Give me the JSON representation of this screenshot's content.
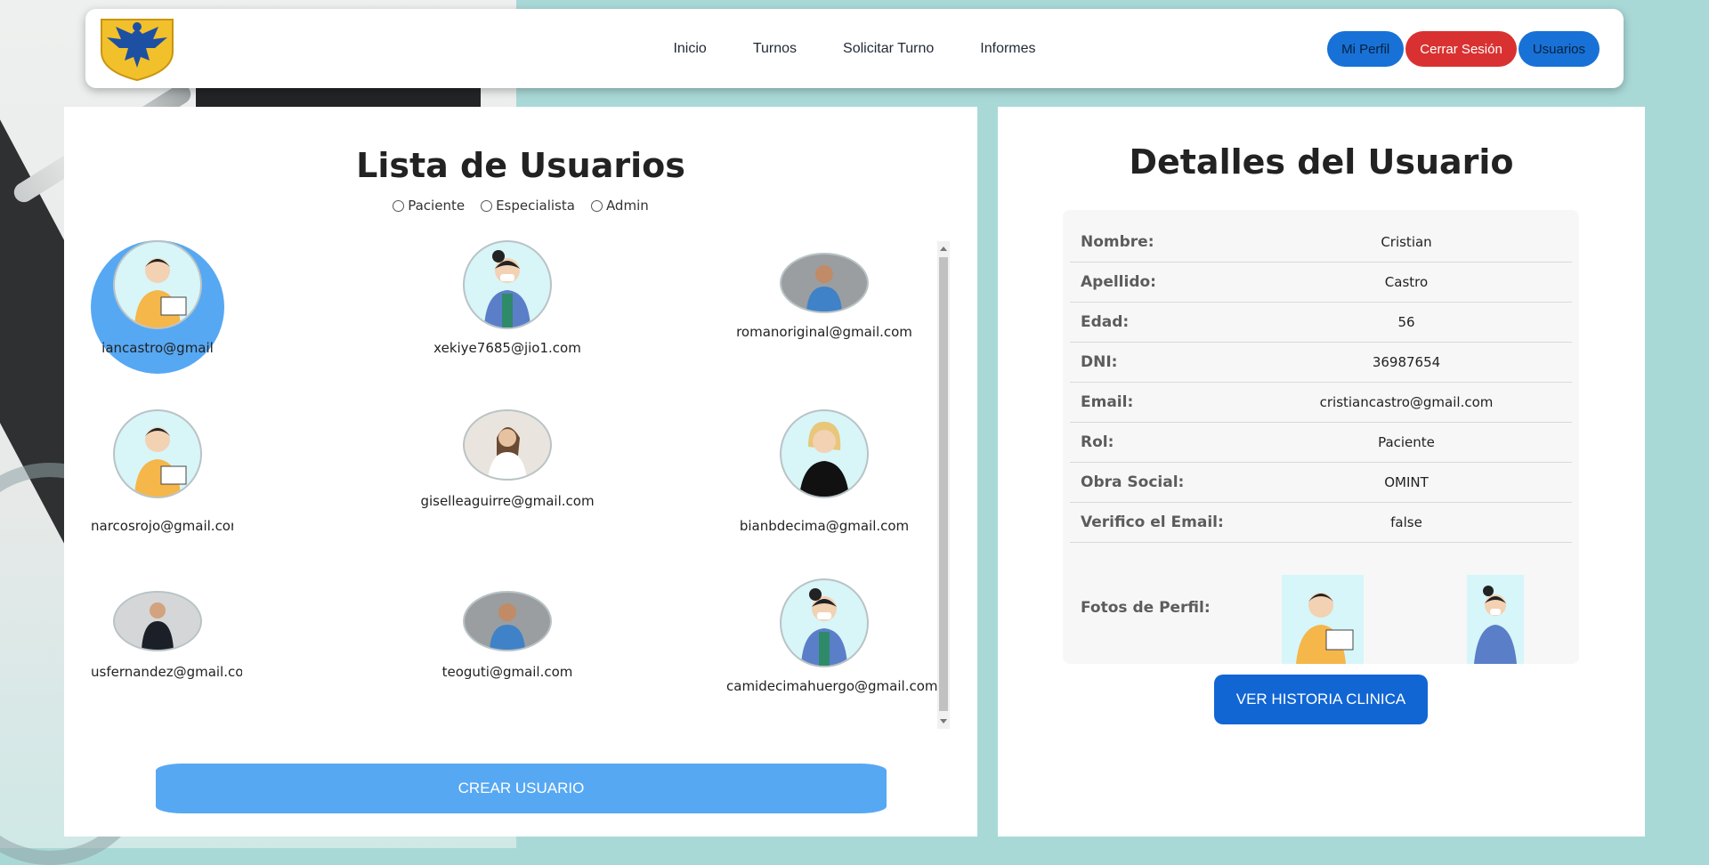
{
  "nav": {
    "links": [
      "Inicio",
      "Turnos",
      "Solicitar Turno",
      "Informes"
    ],
    "mi_perfil": "Mi Perfil",
    "cerrar_sesion": "Cerrar Sesión",
    "usuarios": "Usuarios"
  },
  "list": {
    "title": "Lista de Usuarios",
    "filters": [
      "Paciente",
      "Especialista",
      "Admin"
    ],
    "users": [
      {
        "email": "cristiancastro@gmail.com",
        "display": "iancastro@gmail",
        "avatar": "cartoon-man-laptop-icon",
        "selected": true
      },
      {
        "email": "xekiye7685@jio1.com",
        "display": "xekiye7685@jio1.com",
        "avatar": "cartoon-woman-mask-icon"
      },
      {
        "email": "romanoriginal@gmail.com",
        "display": "romanoriginal@gmail.com",
        "avatar": "photo-man-icon"
      },
      {
        "email": "marcosrojo@gmail.com",
        "display": "narcosrojo@gmail.com",
        "avatar": "cartoon-man-laptop-icon"
      },
      {
        "email": "giselleaguirre@gmail.com",
        "display": "giselleaguirre@gmail.com",
        "avatar": "photo-doctor-woman-icon"
      },
      {
        "email": "bianbdecima@gmail.com",
        "display": "bianbdecima@gmail.com",
        "avatar": "cartoon-woman-blonde-icon"
      },
      {
        "email": "usfernandez@gmail.com",
        "display": "usfernandez@gmail.com",
        "avatar": "photo-man-suit-icon"
      },
      {
        "email": "teoguti@gmail.com",
        "display": "teoguti@gmail.com",
        "avatar": "photo-man-icon"
      },
      {
        "email": "camidecimahuergo@gmail.com",
        "display": "camidecimahuergo@gmail.com",
        "avatar": "cartoon-woman-mask-icon"
      }
    ],
    "crear_label": "CREAR USUARIO"
  },
  "details": {
    "title": "Detalles del Usuario",
    "rows": [
      {
        "label": "Nombre:",
        "value": "Cristian"
      },
      {
        "label": "Apellido:",
        "value": "Castro"
      },
      {
        "label": "Edad:",
        "value": "56"
      },
      {
        "label": "DNI:",
        "value": "36987654"
      },
      {
        "label": "Email:",
        "value": "cristiancastro@gmail.com"
      },
      {
        "label": "Rol:",
        "value": "Paciente"
      },
      {
        "label": "Obra Social:",
        "value": "OMINT"
      },
      {
        "label": "Verifico el Email:",
        "value": "false"
      }
    ],
    "fotos_label": "Fotos de Perfil:",
    "historia_label": "VER HISTORIA CLINICA"
  },
  "colors": {
    "accent_blue": "#1871d6",
    "light_blue": "#56a8f3",
    "danger": "#d93131",
    "background": "#a9d9d7"
  }
}
